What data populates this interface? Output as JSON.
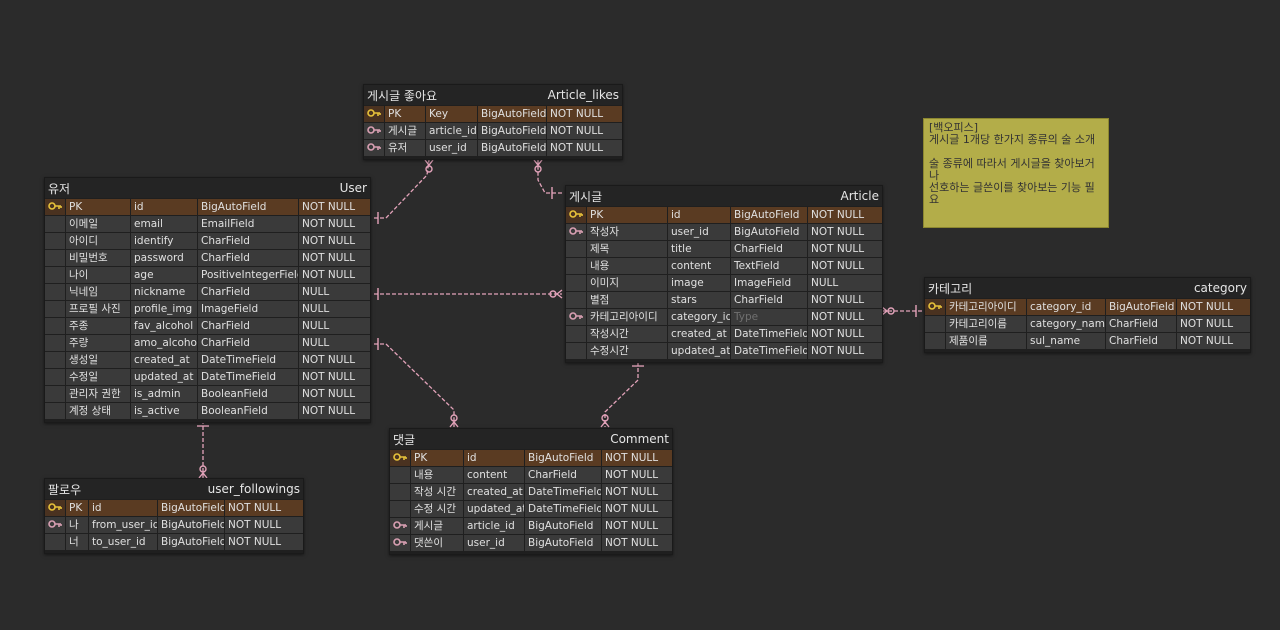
{
  "colors": {
    "background": "#2b2b2b",
    "pk_row": "#5a3b22",
    "fk_icon": "#d9a0b3",
    "pk_icon": "#e8c23a",
    "note": "#b3ad49",
    "link": "#e3a3ba"
  },
  "tables": [
    {
      "id": "user",
      "title_ko": "유저",
      "title_en": "User",
      "rows": [
        {
          "key": "pk",
          "label": "PK",
          "name": "id",
          "type": "BigAutoField",
          "null": "NOT NULL"
        },
        {
          "key": "",
          "label": "이메일",
          "name": "email",
          "type": "EmailField",
          "null": "NOT NULL"
        },
        {
          "key": "",
          "label": "아이디",
          "name": "identify",
          "type": "CharField",
          "null": "NOT NULL"
        },
        {
          "key": "",
          "label": "비밀번호",
          "name": "password",
          "type": "CharField",
          "null": "NOT NULL"
        },
        {
          "key": "",
          "label": "나이",
          "name": "age",
          "type": "PositiveIntegerField",
          "null": "NOT NULL"
        },
        {
          "key": "",
          "label": "닉네임",
          "name": "nickname",
          "type": "CharField",
          "null": "NULL"
        },
        {
          "key": "",
          "label": "프로필 사진",
          "name": "profile_img",
          "type": "ImageField",
          "null": "NULL"
        },
        {
          "key": "",
          "label": "주종",
          "name": "fav_alcohol",
          "type": "CharField",
          "null": "NULL"
        },
        {
          "key": "",
          "label": "주량",
          "name": "amo_alcohol",
          "type": "CharField",
          "null": "NULL"
        },
        {
          "key": "",
          "label": "생성일",
          "name": "created_at",
          "type": "DateTimeField",
          "null": "NOT NULL"
        },
        {
          "key": "",
          "label": "수정일",
          "name": "updated_at",
          "type": "DateTimeField",
          "null": "NOT NULL"
        },
        {
          "key": "",
          "label": "관리자 권한",
          "name": "is_admin",
          "type": "BooleanField",
          "null": "NOT NULL"
        },
        {
          "key": "",
          "label": "계정 상태",
          "name": "is_active",
          "type": "BooleanField",
          "null": "NOT NULL"
        }
      ]
    },
    {
      "id": "article_likes",
      "title_ko": "게시글 좋아요",
      "title_en": "Article_likes",
      "rows": [
        {
          "key": "pk",
          "label": "PK",
          "name": "Key",
          "type": "BigAutoField",
          "null": "NOT NULL"
        },
        {
          "key": "fk",
          "label": "게시글",
          "name": "article_id",
          "type": "BigAutoField",
          "null": "NOT NULL"
        },
        {
          "key": "fk",
          "label": "유저",
          "name": "user_id",
          "type": "BigAutoField",
          "null": "NOT NULL"
        }
      ]
    },
    {
      "id": "article",
      "title_ko": "게시글",
      "title_en": "Article",
      "rows": [
        {
          "key": "pk",
          "label": "PK",
          "name": "id",
          "type": "BigAutoField",
          "null": "NOT NULL"
        },
        {
          "key": "fk",
          "label": "작성자",
          "name": "user_id",
          "type": "BigAutoField",
          "null": "NOT NULL"
        },
        {
          "key": "",
          "label": "제목",
          "name": "title",
          "type": "CharField",
          "null": "NOT NULL"
        },
        {
          "key": "",
          "label": "내용",
          "name": "content",
          "type": "TextField",
          "null": "NOT NULL"
        },
        {
          "key": "",
          "label": "이미지",
          "name": "image",
          "type": "ImageField",
          "null": "NULL"
        },
        {
          "key": "",
          "label": "별점",
          "name": "stars",
          "type": "CharField",
          "null": "NOT NULL"
        },
        {
          "key": "fk",
          "label": "카테고리아이디",
          "name": "category_id",
          "type": "Type",
          "type_muted": true,
          "null": "NOT NULL"
        },
        {
          "key": "",
          "label": "작성시간",
          "name": "created_at",
          "type": "DateTimeField",
          "null": "NOT NULL"
        },
        {
          "key": "",
          "label": "수정시간",
          "name": "updated_at",
          "type": "DateTimeField",
          "null": "NOT NULL"
        }
      ]
    },
    {
      "id": "category",
      "title_ko": "카테고리",
      "title_en": "category",
      "rows": [
        {
          "key": "pk",
          "label": "카테고리아이디",
          "name": "category_id",
          "type": "BigAutoField",
          "null": "NOT NULL"
        },
        {
          "key": "",
          "label": "카테고리이름",
          "name": "category_name",
          "type": "CharField",
          "null": "NOT NULL"
        },
        {
          "key": "",
          "label": "제품이름",
          "name": "sul_name",
          "type": "CharField",
          "null": "NOT NULL"
        }
      ]
    },
    {
      "id": "comment",
      "title_ko": "댓글",
      "title_en": "Comment",
      "rows": [
        {
          "key": "pk",
          "label": "PK",
          "name": "id",
          "type": "BigAutoField",
          "null": "NOT NULL"
        },
        {
          "key": "",
          "label": "내용",
          "name": "content",
          "type": "CharField",
          "null": "NOT NULL"
        },
        {
          "key": "",
          "label": "작성 시간",
          "name": "created_at",
          "type": "DateTimeField",
          "null": "NOT NULL"
        },
        {
          "key": "",
          "label": "수정 시간",
          "name": "updated_at",
          "type": "DateTimeField",
          "null": "NOT NULL"
        },
        {
          "key": "fk",
          "label": "게시글",
          "name": "article_id",
          "type": "BigAutoField",
          "null": "NOT NULL"
        },
        {
          "key": "fk",
          "label": "댓쓴이",
          "name": "user_id",
          "type": "BigAutoField",
          "null": "NOT NULL"
        }
      ]
    },
    {
      "id": "follow",
      "title_ko": "팔로우",
      "title_en": "user_followings",
      "rows": [
        {
          "key": "pk",
          "label": "PK",
          "name": "id",
          "type": "BigAutoField",
          "null": "NOT NULL"
        },
        {
          "key": "fk",
          "label": "나",
          "name": "from_user_id",
          "type": "BigAutoField",
          "null": "NOT NULL"
        },
        {
          "key": "",
          "label": "너",
          "name": "to_user_id",
          "type": "BigAutoField",
          "null": "NOT NULL"
        }
      ]
    }
  ],
  "note": {
    "text": "[백오피스]\n게시글 1개당 한가지 종류의 술 소개\n\n술 종류에 따라서 게시글을 찾아보거나\n선호하는 글쓴이를 찾아보는 기능 필요"
  }
}
